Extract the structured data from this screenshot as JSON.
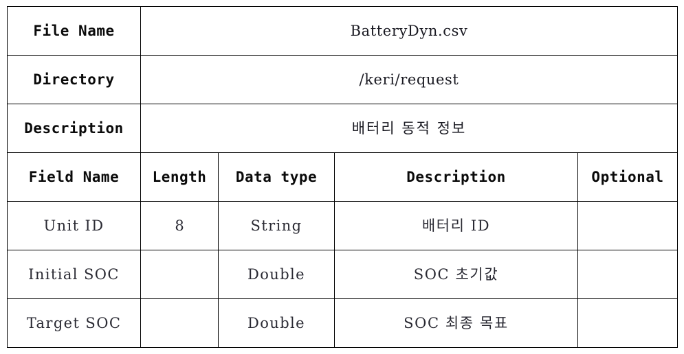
{
  "document": {
    "kind": "file-specification-table",
    "background_color": "#ffffff",
    "border_color": "#000000",
    "text_color": "#111111"
  },
  "meta_rows": [
    {
      "label": "File Name",
      "value": "BatteryDyn.csv",
      "is_korean": false
    },
    {
      "label": "Directory",
      "value": "/keri/request",
      "is_korean": false
    },
    {
      "label": "Description",
      "value": "배터리 동적 정보",
      "is_korean": true
    }
  ],
  "field_table": {
    "headers": {
      "field_name": "Field Name",
      "length": "Length",
      "data_type": "Data type",
      "description": "Description",
      "optional": "Optional"
    },
    "rows": [
      {
        "field_name": "Unit ID",
        "length": "8",
        "data_type": "String",
        "description": "배터리 ID",
        "optional": ""
      },
      {
        "field_name": "Initial SOC",
        "length": "",
        "data_type": "Double",
        "description": "SOC 초기값",
        "optional": ""
      },
      {
        "field_name": "Target SOC",
        "length": "",
        "data_type": "Double",
        "description": "SOC 최종 목표",
        "optional": ""
      }
    ]
  }
}
